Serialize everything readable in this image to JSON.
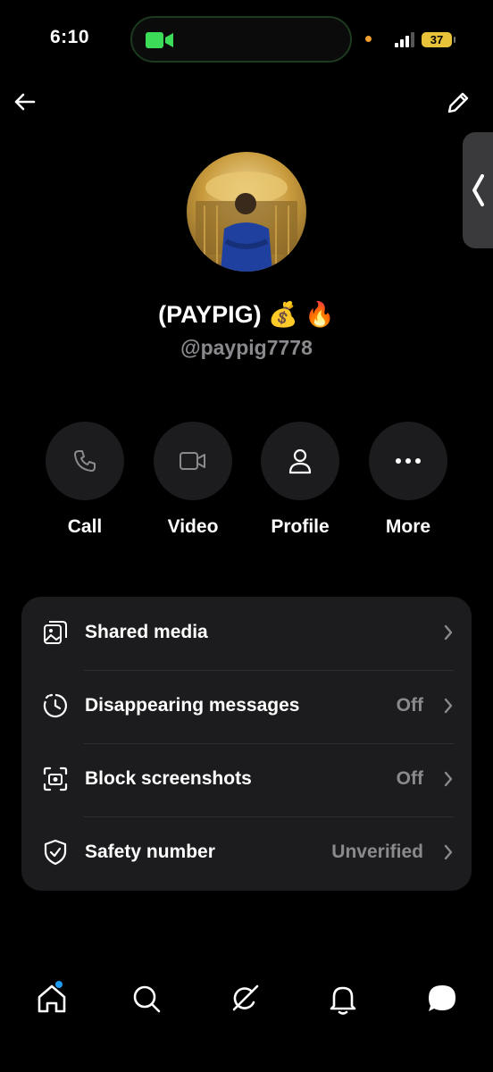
{
  "status_bar": {
    "time": "6:10",
    "battery": "37"
  },
  "profile": {
    "name": "(PAYPIG) 💰 🔥",
    "handle": "@paypig7778"
  },
  "actions": [
    {
      "label": "Call",
      "icon": "phone-icon"
    },
    {
      "label": "Video",
      "icon": "video-icon"
    },
    {
      "label": "Profile",
      "icon": "person-icon"
    },
    {
      "label": "More",
      "icon": "more-dots-icon"
    }
  ],
  "settings": [
    {
      "label": "Shared media",
      "value": "",
      "icon": "media-icon"
    },
    {
      "label": "Disappearing messages",
      "value": "Off",
      "icon": "timer-icon"
    },
    {
      "label": "Block screenshots",
      "value": "Off",
      "icon": "screenshot-icon"
    },
    {
      "label": "Safety number",
      "value": "Unverified",
      "icon": "shield-check-icon"
    }
  ],
  "bottom_nav": [
    "home-icon",
    "search-icon",
    "grok-icon",
    "bell-icon",
    "messages-icon"
  ],
  "colors": {
    "accent": "#1d9bf0",
    "card": "#1c1c1e",
    "muted": "#8a8a8e",
    "call_indicator": "#3ddc58",
    "battery": "#e8c33a"
  }
}
